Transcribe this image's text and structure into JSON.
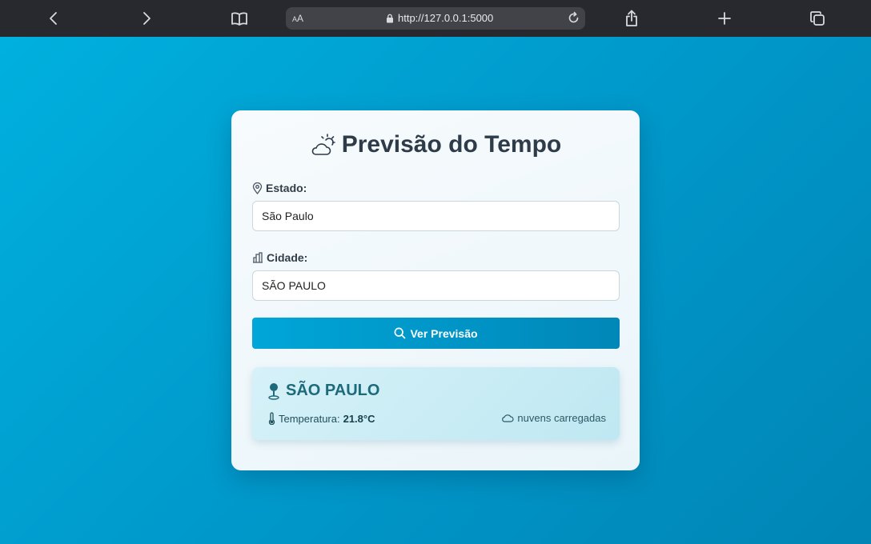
{
  "browser": {
    "aa_label": "AA",
    "url": "http://127.0.0.1:5000"
  },
  "app": {
    "title": "Previsão do Tempo",
    "estado_label": "Estado:",
    "estado_value": "São Paulo",
    "cidade_label": "Cidade:",
    "cidade_value": "SÃO PAULO",
    "submit_label": "Ver Previsão"
  },
  "result": {
    "city": "SÃO PAULO",
    "temp_label": "Temperatura:",
    "temp_value": "21.8°C",
    "description": "nuvens carregadas"
  },
  "colors": {
    "page_bg": "#00a3d4",
    "accent": "#0095c5",
    "title_text": "#2e3b48",
    "result_city": "#1d6a7a"
  },
  "icons": [
    "back-icon",
    "forward-icon",
    "bookmarks-icon",
    "lock-icon",
    "reload-icon",
    "share-icon",
    "new-tab-icon",
    "tabs-icon",
    "weather-icon",
    "location-pin-icon",
    "building-icon",
    "search-icon",
    "map-pin-icon",
    "thermometer-icon",
    "cloud-icon"
  ]
}
